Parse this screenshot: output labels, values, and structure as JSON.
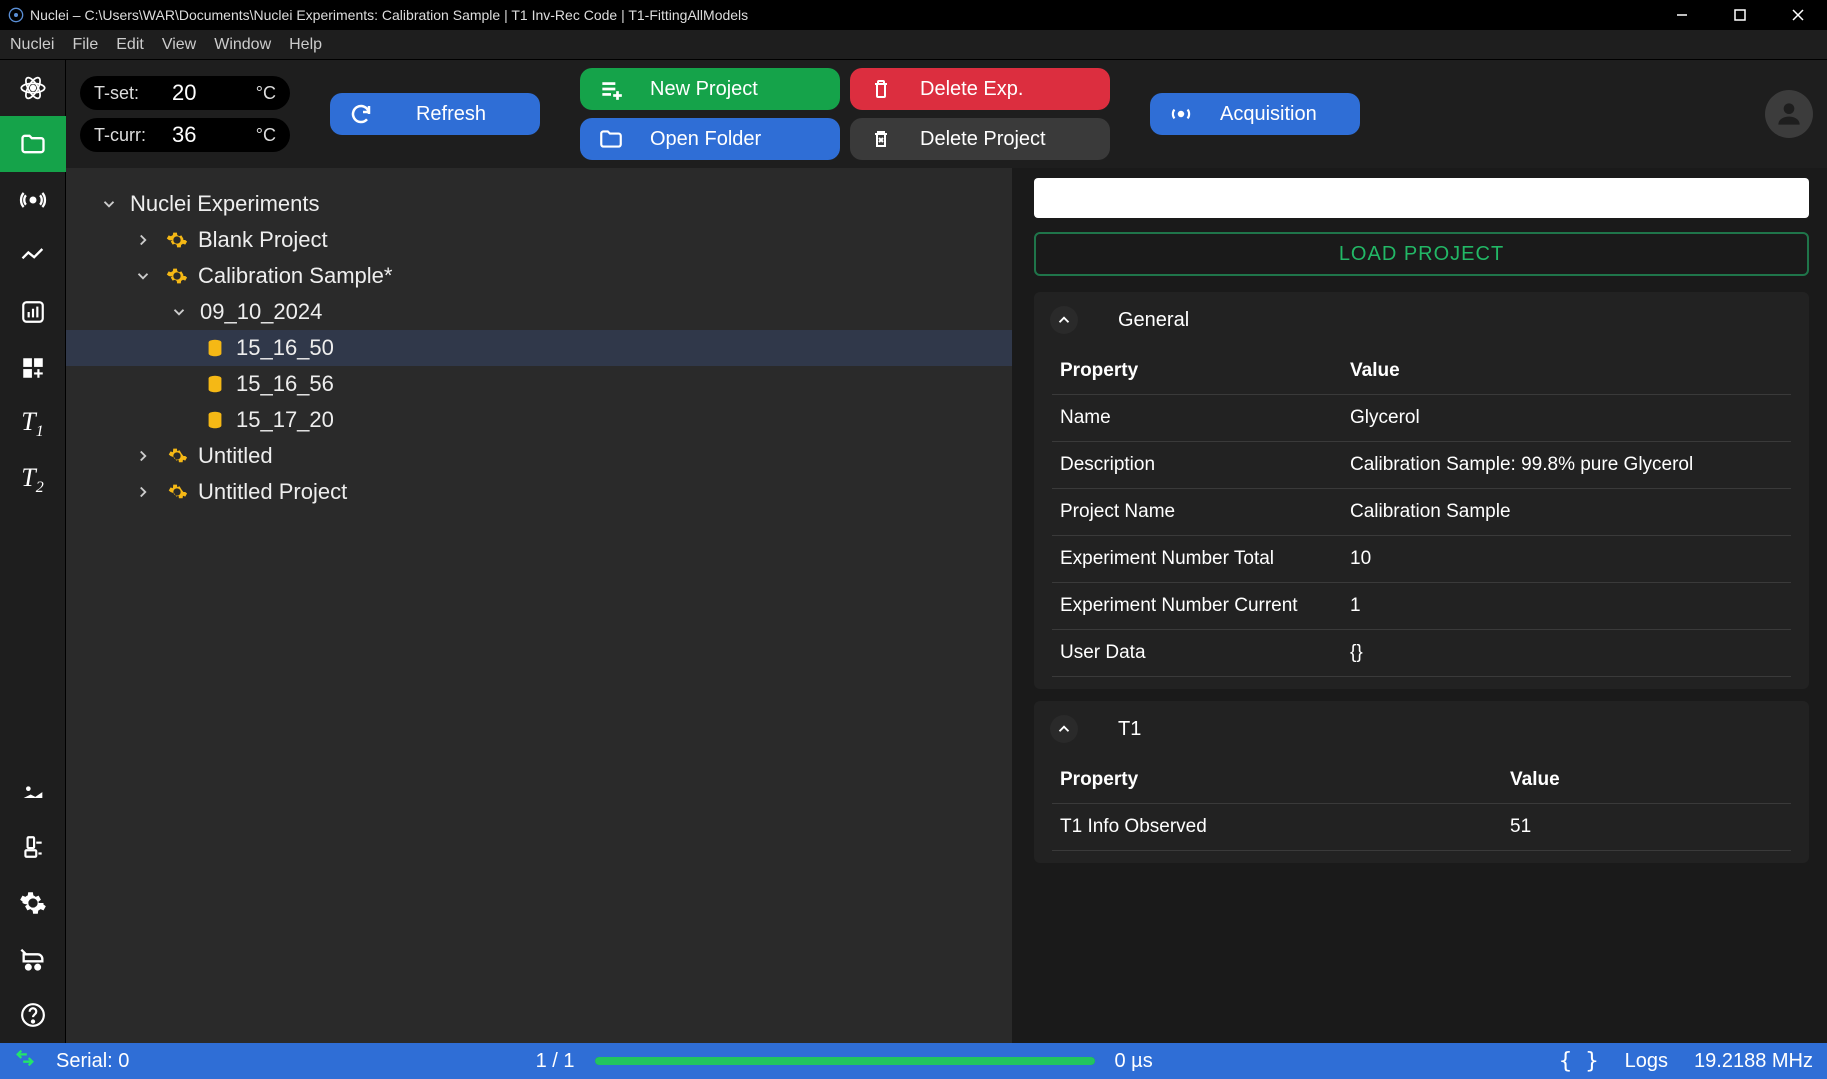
{
  "app": {
    "title": "Nuclei – C:\\Users\\WAR\\Documents\\Nuclei Experiments: Calibration Sample | T1 Inv-Rec Code | T1-FittingAllModels"
  },
  "menu": [
    "Nuclei",
    "File",
    "Edit",
    "View",
    "Window",
    "Help"
  ],
  "toolbar": {
    "tset_label": "T-set:",
    "tset_val": "20",
    "tset_unit": "°C",
    "tcurr_label": "T-curr:",
    "tcurr_val": "36",
    "tcurr_unit": "°C",
    "refresh": "Refresh",
    "new_project": "New Project",
    "open_folder": "Open Folder",
    "delete_exp": "Delete Exp.",
    "delete_project": "Delete Project",
    "acquisition": "Acquisition"
  },
  "tree": {
    "root": "Nuclei Experiments",
    "items": [
      {
        "label": "Blank Project"
      },
      {
        "label": "Calibration Sample*"
      },
      {
        "label": "09_10_2024"
      },
      {
        "label": "15_16_50"
      },
      {
        "label": "15_16_56"
      },
      {
        "label": "15_17_20"
      },
      {
        "label": "Untitled"
      },
      {
        "label": "Untitled Project"
      }
    ]
  },
  "detail": {
    "load_project": "LOAD PROJECT",
    "general": {
      "title": "General",
      "header_k": "Property",
      "header_v": "Value",
      "rows": [
        {
          "k": "Name",
          "v": "Glycerol"
        },
        {
          "k": "Description",
          "v": "Calibration Sample: 99.8% pure Glycerol"
        },
        {
          "k": "Project Name",
          "v": "Calibration Sample"
        },
        {
          "k": "Experiment Number Total",
          "v": "10"
        },
        {
          "k": "Experiment Number Current",
          "v": "1"
        },
        {
          "k": "User Data",
          "v": "{}"
        }
      ]
    },
    "t1": {
      "title": "T1",
      "header_k": "Property",
      "header_v": "Value",
      "rows": [
        {
          "k": "T1 Info Observed",
          "v": "51"
        }
      ]
    }
  },
  "status": {
    "serial": "Serial: 0",
    "page": "1 / 1",
    "time": "0 µs",
    "logs": "Logs",
    "freq": "19.2188 MHz",
    "progress_pct": 100
  }
}
